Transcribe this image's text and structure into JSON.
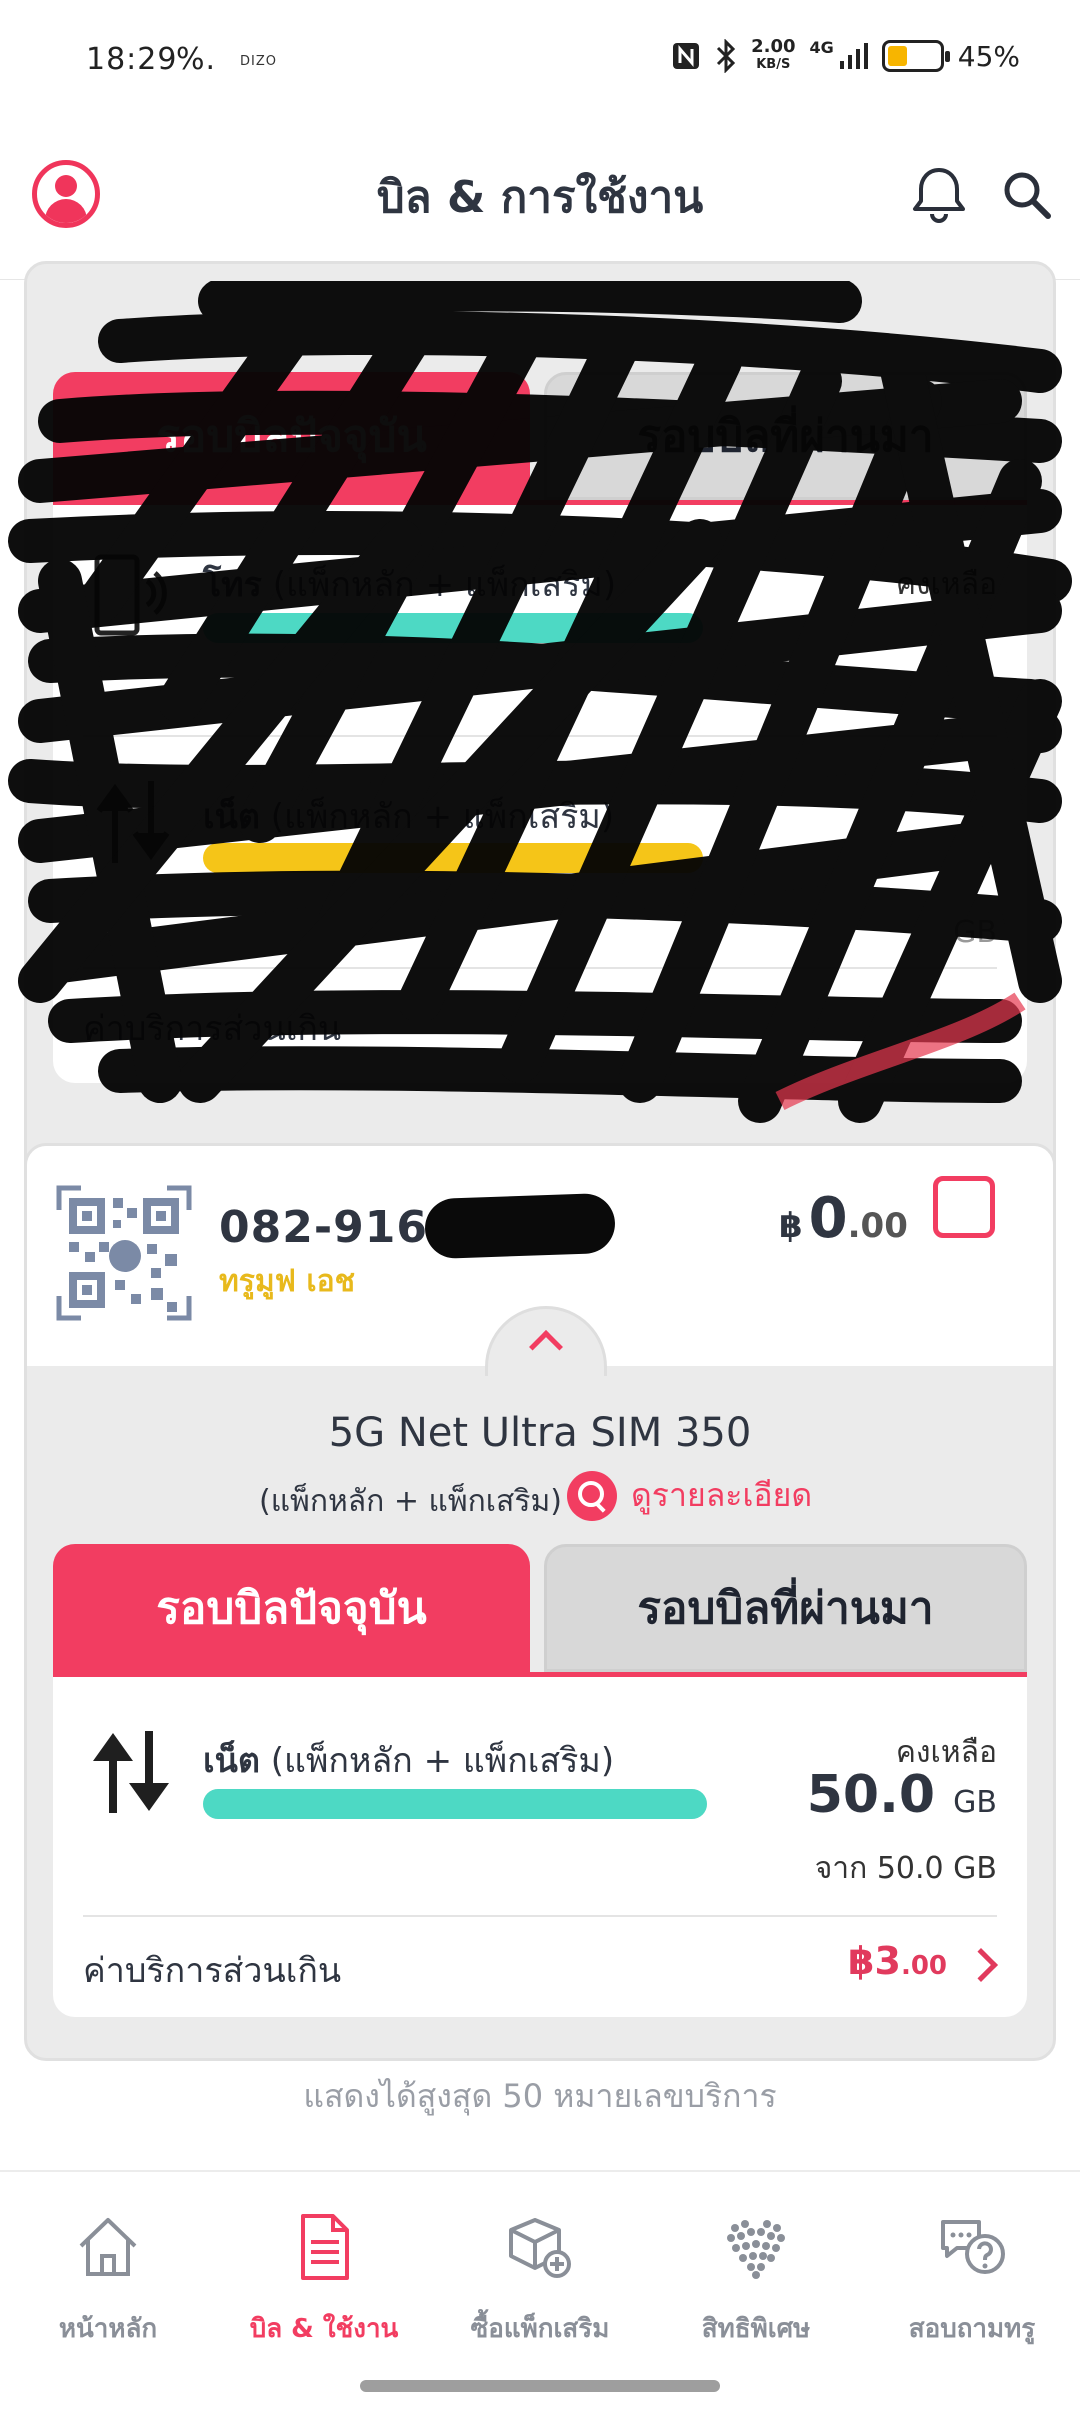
{
  "status_bar": {
    "time": "18:29",
    "percent_glyph": "%.",
    "carrier_small": "DIZO",
    "speed_top": "2.00",
    "speed_bottom": "KB/S",
    "network": "4G",
    "battery_percent": "45%",
    "battery_level": 0.45
  },
  "header": {
    "title": "บิล & การใช้งาน"
  },
  "card_top": {
    "tab_current": "รอบบิลปัจจุบัน",
    "tab_past": "รอบบิลที่ผ่านมา",
    "voice_title_bold": "โทร",
    "voice_title_rest": " (แพ็กหลัก + แพ็กเสริม)",
    "voice_remaining": "คงเหลือ",
    "net_title_bold": "เน็ต",
    "net_title_rest": " (แพ็กหลัก + แพ็กเสริม)",
    "net_unit": "GB",
    "overage_label": "ค่าบริการส่วนเกิน"
  },
  "card_bottom": {
    "phone": "082-916-",
    "plan_label": "ทรูมูฟ เอช",
    "amount_currency": "฿",
    "amount_int": "0",
    "amount_dec": ".00",
    "package_title": "5G Net Ultra SIM 350",
    "package_sub": "(แพ็กหลัก +  แพ็กเสริม)",
    "detail_link": "ดูรายละเอียด",
    "tab_current": "รอบบิลปัจจุบัน",
    "tab_past": "รอบบิลที่ผ่านมา",
    "net_title_bold": "เน็ต",
    "net_title_rest": " (แพ็กหลัก + แพ็กเสริม)",
    "remaining_label": "คงเหลือ",
    "remaining_value": "50.0",
    "remaining_unit": "GB",
    "remaining_from": "จาก 50.0 GB",
    "remaining_fraction": 1.0,
    "overage_label": "ค่าบริการส่วนเกิน",
    "overage_currency": "฿",
    "overage_int": "3",
    "overage_dec": ".00"
  },
  "footnote": "แสดงได้สูงสุด 50 หมายเลขบริการ",
  "bottom_nav": [
    {
      "label": "หน้าหลัก",
      "icon": "home-icon"
    },
    {
      "label": "บิล & ใช้งาน",
      "icon": "bill-icon"
    },
    {
      "label": "ซื้อแพ็กเสริม",
      "icon": "box-add-icon"
    },
    {
      "label": "สิทธิพิเศษ",
      "icon": "heart-dots-icon"
    },
    {
      "label": "สอบถามทรู",
      "icon": "chat-help-icon"
    }
  ],
  "colors": {
    "accent": "#f23d61",
    "bar_teal": "#4dd9c4",
    "plan_yellow": "#e8b91c"
  }
}
